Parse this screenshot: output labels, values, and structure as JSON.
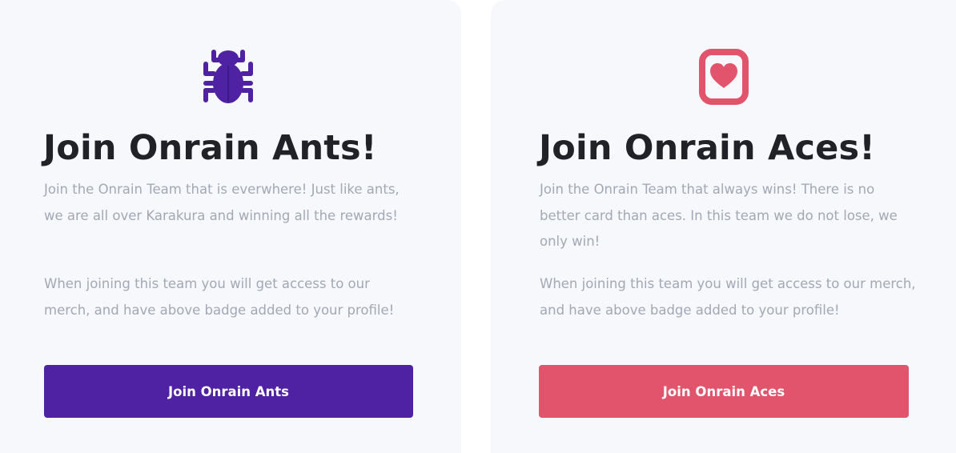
{
  "teams": [
    {
      "icon": "bug-icon",
      "accent": "#4f21a3",
      "title": "Join Onrain Ants!",
      "description": "Join the Onrain Team that is everwhere! Just like ants, we are all over Karakura and winning all the rewards!",
      "benefits": "When joining this team you will get access to our merch, and have above badge added to your profile!",
      "button_label": "Join Onrain Ants"
    },
    {
      "icon": "heart-card-icon",
      "accent": "#e1546c",
      "title": "Join Onrain Aces!",
      "description": "Join the Onrain Team that always wins! There is no better card than aces. In this team we do not lose, we only win!",
      "benefits": "When joining this team you will get access to our merch, and have above badge added to your profile!",
      "button_label": "Join Onrain Aces"
    }
  ]
}
